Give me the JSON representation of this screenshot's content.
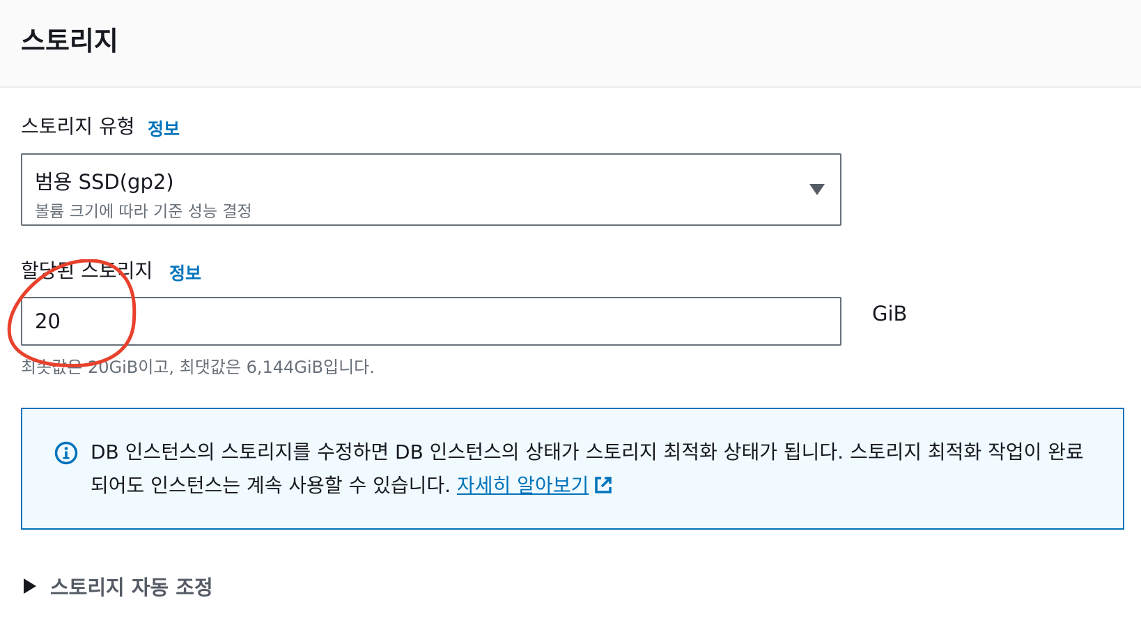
{
  "header": {
    "title": "스토리지"
  },
  "storage_type": {
    "label": "스토리지 유형",
    "info": "정보",
    "selected_value": "범용 SSD(gp2)",
    "selected_description": "볼륨 크기에 따라 기준 성능 결정"
  },
  "allocated_storage": {
    "label": "할당된 스토리지",
    "info": "정보",
    "value": "20",
    "unit": "GiB",
    "hint": "최솟값은 20GiB이고, 최댓값은 6,144GiB입니다."
  },
  "alert": {
    "text": "DB 인스턴스의 스토리지를 수정하면 DB 인스턴스의 상태가 스토리지 최적화 상태가 됩니다. 스토리지 최적화 작업이 완료되어도 인스턴스는 계속 사용할 수 있습니다.",
    "link": "자세히 알아보기"
  },
  "autoscaling": {
    "label": "스토리지 자동 조정"
  },
  "colors": {
    "link": "#0073bb",
    "alert_border": "#0073bb",
    "alert_background": "#f1faff",
    "annotation": "#e8412c"
  },
  "icons": {
    "alert": "info-circle-icon",
    "external": "external-link-icon",
    "select": "caret-down-icon",
    "expander": "caret-right-icon"
  }
}
